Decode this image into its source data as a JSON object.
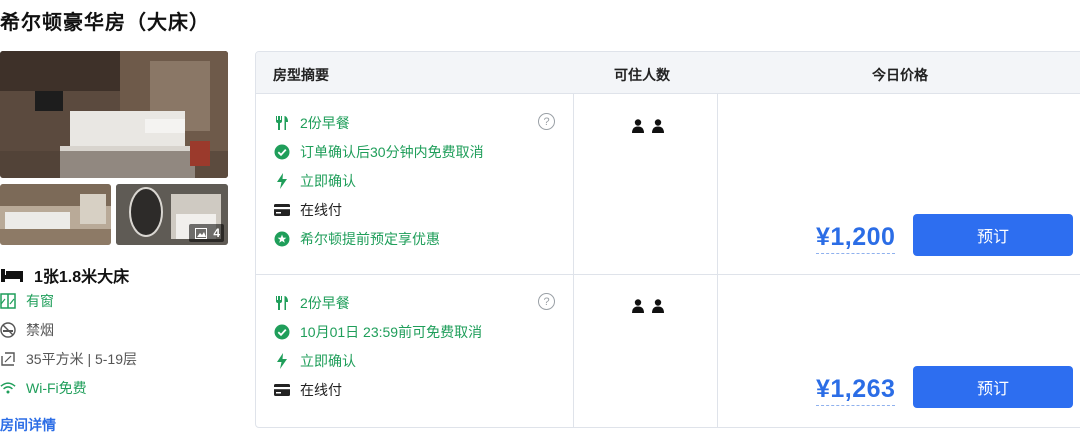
{
  "room": {
    "title": "希尔顿豪华房（大床）",
    "photo_count": "4",
    "bed": "1张1.8米大床",
    "features": [
      {
        "icon": "window-icon",
        "label": "有窗",
        "tone": "green"
      },
      {
        "icon": "no-smoking-icon",
        "label": "禁烟",
        "tone": "gray"
      },
      {
        "icon": "area-icon",
        "label": "35平方米 | 5-19层",
        "tone": "gray"
      },
      {
        "icon": "wifi-icon",
        "label": "Wi-Fi免费",
        "tone": "green"
      }
    ],
    "detail_link": "房间详情"
  },
  "table": {
    "headers": [
      "房型摘要",
      "可住人数",
      "今日价格"
    ],
    "offers": [
      {
        "items": [
          {
            "icon": "utensils-icon",
            "label": "2份早餐",
            "tone": "green"
          },
          {
            "icon": "check-circle-icon",
            "label": "订单确认后30分钟内免费取消",
            "tone": "green"
          },
          {
            "icon": "lightning-icon",
            "label": "立即确认",
            "tone": "green"
          },
          {
            "icon": "card-icon",
            "label": "在线付",
            "tone": "dark"
          },
          {
            "icon": "star-badge-icon",
            "label": "希尔顿提前预定享优惠",
            "tone": "green"
          }
        ],
        "guests": 2,
        "price": "¥1,200",
        "book_label": "预订"
      },
      {
        "items": [
          {
            "icon": "utensils-icon",
            "label": "2份早餐",
            "tone": "green"
          },
          {
            "icon": "check-circle-icon",
            "label": "10月01日 23:59前可免费取消",
            "tone": "green"
          },
          {
            "icon": "lightning-icon",
            "label": "立即确认",
            "tone": "green"
          },
          {
            "icon": "card-icon",
            "label": "在线付",
            "tone": "dark"
          }
        ],
        "guests": 2,
        "price": "¥1,263",
        "book_label": "预订"
      }
    ]
  },
  "help_glyph": "?",
  "colors": {
    "green": "#1f9e5a",
    "blue": "#2d6ef0",
    "price": "#2b6de6",
    "border": "#dfe3ea"
  }
}
